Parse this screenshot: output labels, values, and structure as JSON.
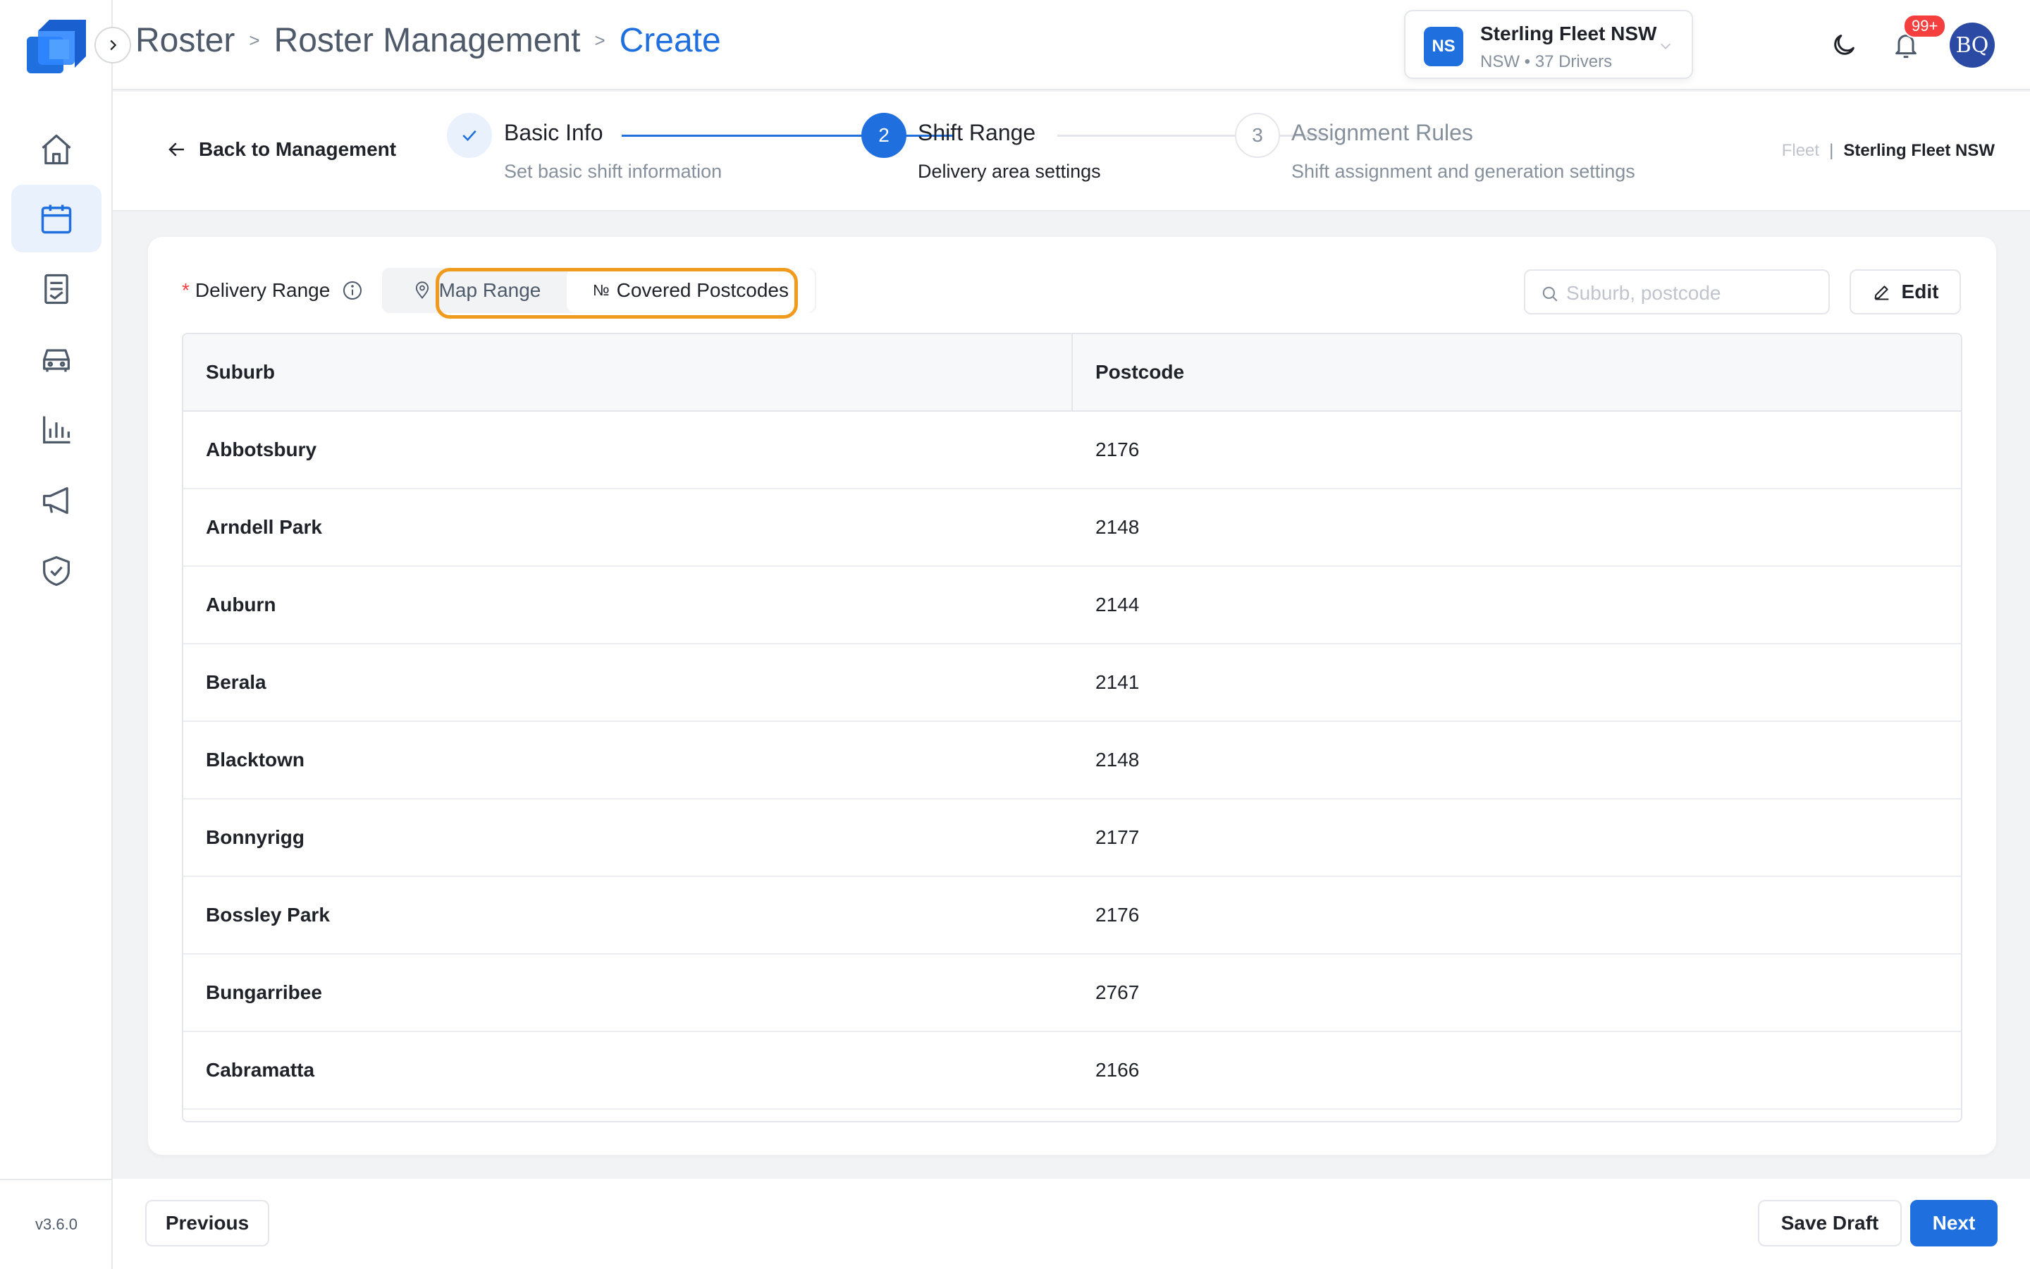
{
  "sidebar": {
    "version": "v3.6.0",
    "items": [
      {
        "icon": "home-icon"
      },
      {
        "icon": "calendar-icon",
        "active": true
      },
      {
        "icon": "document-icon"
      },
      {
        "icon": "car-icon"
      },
      {
        "icon": "chart-icon"
      },
      {
        "icon": "megaphone-icon"
      },
      {
        "icon": "shield-check-icon"
      }
    ]
  },
  "header": {
    "breadcrumbs": [
      "Roster",
      "Roster Management",
      "Create"
    ],
    "separator": ">",
    "fleet": {
      "badge": "NS",
      "name": "Sterling Fleet NSW",
      "subtitle": "NSW • 37 Drivers"
    },
    "notification_count": "99+",
    "avatar_initials": "BQ"
  },
  "stepper": {
    "back_label": "Back to Management",
    "steps": [
      {
        "number": "1",
        "title": "Basic Info",
        "description": "Set basic shift information",
        "status": "done"
      },
      {
        "number": "2",
        "title": "Shift Range",
        "description": "Delivery area settings",
        "status": "active"
      },
      {
        "number": "3",
        "title": "Assignment Rules",
        "description": "Shift assignment and generation settings",
        "status": "pending"
      }
    ],
    "fleet_crumb": {
      "label": "Fleet",
      "separator": "|",
      "value": "Sterling Fleet NSW"
    }
  },
  "range": {
    "required_mark": "*",
    "label": "Delivery Range",
    "tabs": {
      "map": "Map Range",
      "postcodes_prefix": "№",
      "postcodes": "Covered Postcodes"
    },
    "search_placeholder": "Suburb, postcode",
    "edit_label": "Edit"
  },
  "table": {
    "columns": [
      "Suburb",
      "Postcode"
    ],
    "rows": [
      {
        "suburb": "Abbotsbury",
        "postcode": "2176"
      },
      {
        "suburb": "Arndell Park",
        "postcode": "2148"
      },
      {
        "suburb": "Auburn",
        "postcode": "2144"
      },
      {
        "suburb": "Berala",
        "postcode": "2141"
      },
      {
        "suburb": "Blacktown",
        "postcode": "2148"
      },
      {
        "suburb": "Bonnyrigg",
        "postcode": "2177"
      },
      {
        "suburb": "Bossley Park",
        "postcode": "2176"
      },
      {
        "suburb": "Bungarribee",
        "postcode": "2767"
      },
      {
        "suburb": "Cabramatta",
        "postcode": "2166"
      }
    ]
  },
  "footer": {
    "previous": "Previous",
    "save_draft": "Save Draft",
    "next": "Next"
  },
  "colors": {
    "primary": "#1f6fdf",
    "highlight": "#f09b1e",
    "badge_red": "#f53f3f"
  }
}
